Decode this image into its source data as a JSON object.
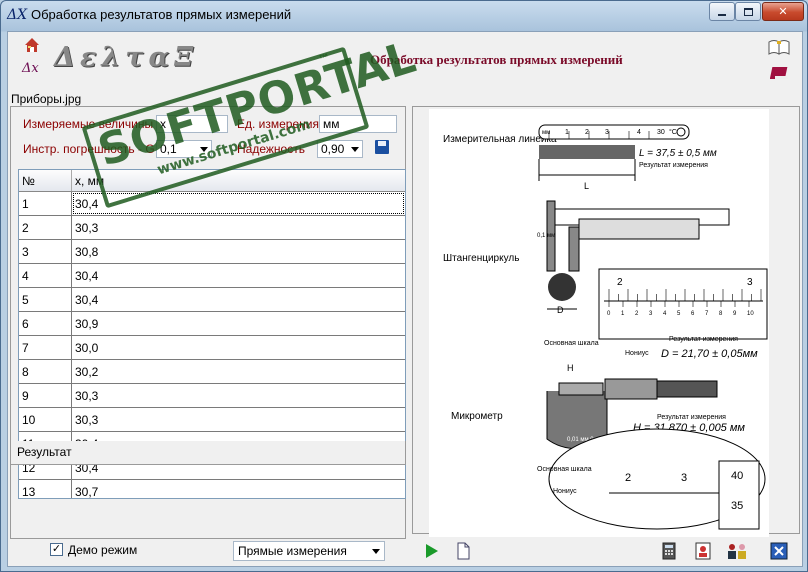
{
  "window": {
    "icon_text": "ΔX",
    "title": "Обработка результатов прямых измерений",
    "buttons": [
      "minimize",
      "maximize",
      "close"
    ]
  },
  "header": {
    "logo_small": "Δx",
    "logo_text": "ΔελταΞ",
    "heading": "Обработка результатов прямых измерений",
    "icons": [
      "home-icon",
      "book-icon",
      "red-book-icon"
    ]
  },
  "image_file": "Приборы.jpg",
  "form": {
    "quantity_label": "Измеряемые величины",
    "quantity_value": "x",
    "unit_label": "Ед. измерения",
    "unit_value": "мм",
    "error_label": "Инстр. погрешность - G",
    "error_value": "0,1",
    "reliability_label": "Надежность",
    "reliability_value": "0,90"
  },
  "table": {
    "headers": [
      "№",
      "x, мм"
    ],
    "rows": [
      {
        "n": "1",
        "v": "30,4"
      },
      {
        "n": "2",
        "v": "30,3"
      },
      {
        "n": "3",
        "v": "30,8"
      },
      {
        "n": "4",
        "v": "30,4"
      },
      {
        "n": "5",
        "v": "30,4"
      },
      {
        "n": "6",
        "v": "30,9"
      },
      {
        "n": "7",
        "v": "30,0"
      },
      {
        "n": "8",
        "v": "30,2"
      },
      {
        "n": "9",
        "v": "30,3"
      },
      {
        "n": "10",
        "v": "30,3"
      },
      {
        "n": "11",
        "v": "30,4"
      },
      {
        "n": "12",
        "v": "30,4"
      },
      {
        "n": "13",
        "v": "30,7"
      }
    ]
  },
  "result_label": "Результат",
  "bottom": {
    "demo_label": "Демо режим",
    "demo_checked": true,
    "mode_value": "Прямые измерения"
  },
  "figure": {
    "ruler_label": "Измерительная линейка",
    "ruler_unit": "мм",
    "ruler_ticks": [
      "1",
      "2",
      "3",
      "4",
      "30"
    ],
    "ruler_deg": "°C",
    "ruler_result": "L = 37,5 ± 0,5 мм",
    "ruler_caption": "Результат измерения",
    "ruler_L": "L",
    "caliper_label": "Штангенциркуль",
    "caliper_D": "D",
    "caliper_unit": "0,1 мм",
    "caliper_scale_a": "2",
    "caliper_scale_b": "3",
    "caliper_vernier": [
      "0",
      "1",
      "2",
      "3",
      "4",
      "5",
      "6",
      "7",
      "8",
      "9",
      "10"
    ],
    "caliper_main_scale": "Основная шкала",
    "caliper_nonius": "Нониус",
    "caliper_result_caption": "Результат измерения",
    "caliper_result": "D = 21,70 ± 0,05мм",
    "micro_label": "Микрометр",
    "micro_H": "H",
    "micro_spec": "0,01 мм 0 - 25 мм",
    "micro_result_caption": "Результат измерения",
    "micro_result": "H = 31,870 ± 0,005 мм",
    "micro_main_scale": "Основная шкала",
    "micro_nonius": "Нониус",
    "micro_scale": [
      "2",
      "3"
    ],
    "micro_thimble": [
      "40",
      "35"
    ]
  },
  "watermark": {
    "text": "SOFTPORTAL",
    "tm": "™",
    "url": "www.softportal.com"
  }
}
